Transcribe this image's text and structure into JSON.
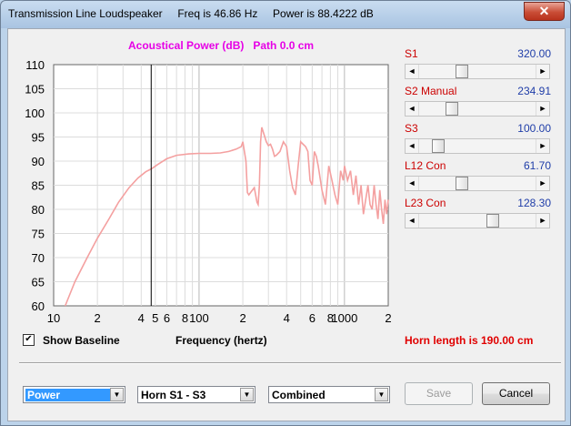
{
  "window": {
    "title": "Transmission Line Loudspeaker     Freq is 46.86 Hz     Power is 88.4222 dB",
    "close_glyph": "✕"
  },
  "chart_data": {
    "type": "line",
    "title": "Acoustical Power (dB)   Path 0.0 cm",
    "xlabel": "Frequency (hertz)",
    "ylabel": "",
    "xscale": "log",
    "xlim": [
      10,
      2000
    ],
    "ylim": [
      60,
      110
    ],
    "y_ticks": [
      "110",
      "105",
      "100",
      "95",
      "90",
      "85",
      "80",
      "75",
      "70",
      "65",
      "60"
    ],
    "x_tick_labels": [
      {
        "x": 10,
        "label": "10"
      },
      {
        "x": 20,
        "label": "2"
      },
      {
        "x": 40,
        "label": "4"
      },
      {
        "x": 50,
        "label": "5"
      },
      {
        "x": 60,
        "label": "6"
      },
      {
        "x": 80,
        "label": "8"
      },
      {
        "x": 100,
        "label": "100"
      },
      {
        "x": 200,
        "label": "2"
      },
      {
        "x": 400,
        "label": "4"
      },
      {
        "x": 600,
        "label": "6"
      },
      {
        "x": 800,
        "label": "8"
      },
      {
        "x": 1000,
        "label": "1000"
      },
      {
        "x": 2000,
        "label": "2"
      }
    ],
    "grid": true,
    "cursor_frequency": 46.86,
    "series_color": "#f4a0a0",
    "series": [
      {
        "name": "",
        "x": [
          12,
          14,
          17,
          20,
          24,
          28,
          33,
          38,
          43,
          47,
          52,
          60,
          70,
          85,
          100,
          120,
          140,
          160,
          180,
          195,
          200,
          205,
          210,
          215,
          220,
          230,
          240,
          250,
          255,
          260,
          265,
          270,
          280,
          290,
          300,
          310,
          320,
          330,
          340,
          360,
          380,
          400,
          420,
          440,
          460,
          480,
          500,
          520,
          540,
          560,
          580,
          600,
          620,
          640,
          660,
          700,
          740,
          780,
          820,
          860,
          900,
          940,
          980,
          1000,
          1050,
          1100,
          1150,
          1200,
          1250,
          1300,
          1350,
          1400,
          1450,
          1500,
          1550,
          1600,
          1650,
          1700,
          1750,
          1800,
          1850,
          1900,
          1950,
          2000
        ],
        "y": [
          60,
          65,
          70,
          74,
          78,
          81.5,
          84.5,
          86.5,
          87.8,
          88.4,
          89.3,
          90.5,
          91.2,
          91.5,
          91.6,
          91.6,
          91.7,
          92,
          92.5,
          93,
          94,
          92,
          90,
          83.5,
          83,
          83.8,
          84.5,
          81.5,
          81,
          85,
          94,
          97,
          95.5,
          94,
          93.2,
          93.5,
          92.5,
          91,
          91.2,
          92,
          94,
          93,
          88,
          84.5,
          83,
          89,
          94,
          93.5,
          93,
          92,
          86,
          85,
          92,
          91,
          89,
          84,
          81,
          89,
          86,
          83,
          81,
          88,
          86,
          89,
          86,
          88,
          83,
          87,
          81,
          85,
          79,
          82,
          85,
          81,
          80,
          85,
          81,
          78,
          84,
          80,
          77,
          82,
          79,
          82
        ]
      }
    ]
  },
  "sliders": [
    {
      "label": "S1",
      "value": "320.00",
      "fraction": 0.35
    },
    {
      "label": "S2  Manual",
      "value": "234.91",
      "fraction": 0.25
    },
    {
      "label": "S3",
      "value": "100.00",
      "fraction": 0.12
    },
    {
      "label": "L12  Con",
      "value": "61.70",
      "fraction": 0.35
    },
    {
      "label": "L23  Con",
      "value": "128.30",
      "fraction": 0.65
    }
  ],
  "show_baseline": {
    "label": "Show Baseline",
    "checked": true,
    "check_glyph": "✔"
  },
  "horn_length": "Horn length is 190.00 cm",
  "dropdowns": {
    "mode": "Power",
    "horn": "Horn S1 - S3",
    "view": "Combined"
  },
  "buttons": {
    "save": "Save",
    "cancel": "Cancel"
  },
  "arrow_glyphs": {
    "left": "◄",
    "right": "►",
    "down": "▼"
  }
}
